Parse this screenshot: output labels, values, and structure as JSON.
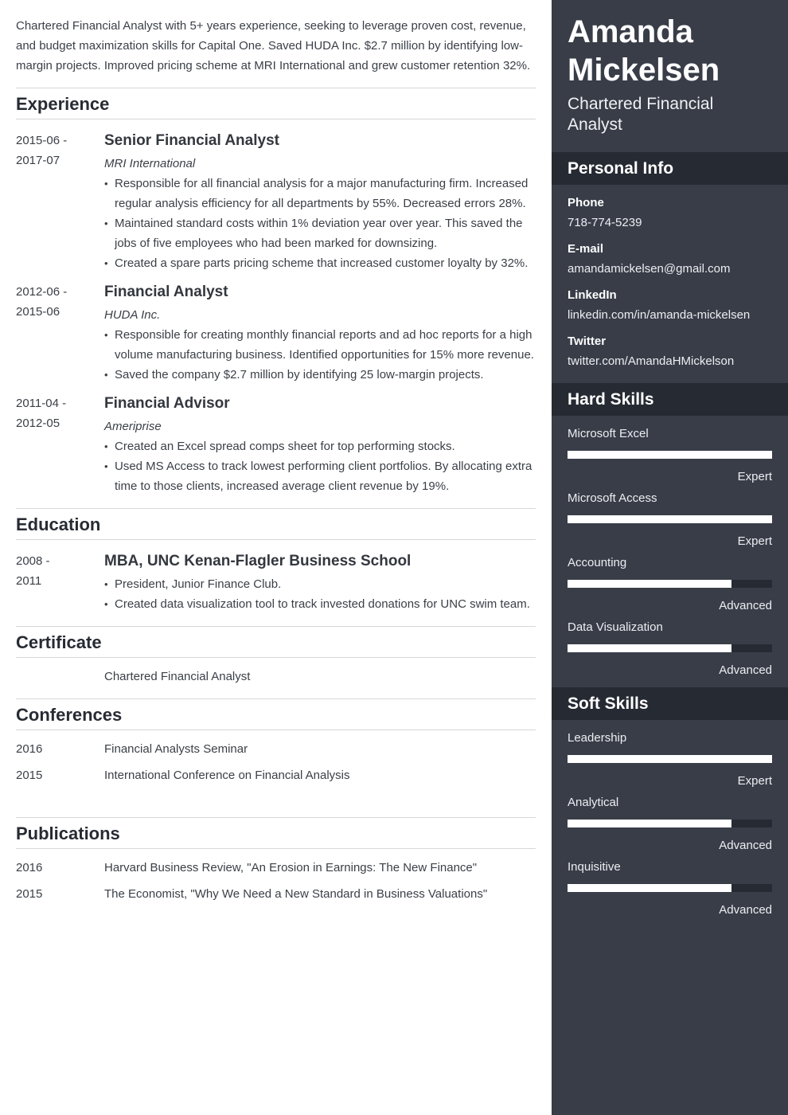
{
  "summary": "Chartered Financial Analyst with 5+ years experience, seeking to leverage proven cost, revenue, and budget maximization skills for Capital One. Saved HUDA Inc. $2.7 million by identifying low-margin projects. Improved pricing scheme at MRI International and grew customer retention 32%.",
  "sections": {
    "experience": "Experience",
    "education": "Education",
    "certificate": "Certificate",
    "conferences": "Conferences",
    "publications": "Publications"
  },
  "experience": [
    {
      "dates": [
        "2015-06 -",
        "2017-07"
      ],
      "role": "Senior Financial Analyst",
      "company": "MRI International",
      "bullets": [
        "Responsible for all financial analysis for a major manufacturing firm. Increased regular analysis efficiency for all departments by 55%. Decreased errors 28%.",
        "Maintained standard costs within 1% deviation year over year. This saved the jobs of five employees who had been marked for downsizing.",
        "Created a spare parts pricing scheme that increased customer loyalty by 32%."
      ]
    },
    {
      "dates": [
        "2012-06 -",
        "2015-06"
      ],
      "role": "Financial Analyst",
      "company": "HUDA Inc.",
      "bullets": [
        "Responsible for creating monthly financial reports and ad hoc reports for a high volume manufacturing business. Identified opportunities for 15% more revenue.",
        "Saved the company $2.7 million by identifying 25 low-margin projects."
      ]
    },
    {
      "dates": [
        "2011-04 -",
        "2012-05"
      ],
      "role": "Financial Advisor",
      "company": "Ameriprise",
      "bullets": [
        "Created an Excel spread comps sheet for top performing stocks.",
        "Used MS Access to track lowest performing client portfolios. By allocating extra time to those clients, increased average client revenue by 19%."
      ]
    }
  ],
  "education": [
    {
      "dates": [
        "2008 -",
        "2011"
      ],
      "degree": "MBA, UNC Kenan-Flagler Business School",
      "bullets": [
        "President, Junior Finance Club.",
        "Created data visualization tool to track invested donations for UNC swim team."
      ]
    }
  ],
  "certificates": [
    "Chartered Financial Analyst"
  ],
  "conferences": [
    {
      "year": "2016",
      "title": "Financial Analysts Seminar"
    },
    {
      "year": "2015",
      "title": "International Conference on Financial Analysis"
    }
  ],
  "publications": [
    {
      "year": "2016",
      "title": "Harvard Business Review, \"An Erosion in Earnings: The New Finance\""
    },
    {
      "year": "2015",
      "title": "The Economist, \"Why We Need a New Standard in Business Valuations\""
    }
  ],
  "sidebar": {
    "name_first": "Amanda",
    "name_last": "Mickelsen",
    "title": "Chartered Financial Analyst",
    "personal_info_heading": "Personal Info",
    "personal_info": [
      {
        "label": "Phone",
        "value": "718-774-5239"
      },
      {
        "label": "E-mail",
        "value": "amandamickelsen@gmail.com"
      },
      {
        "label": "LinkedIn",
        "value": "linkedin.com/in/amanda-mickelsen"
      },
      {
        "label": "Twitter",
        "value": "twitter.com/AmandaHMickelson"
      }
    ],
    "hard_skills_heading": "Hard Skills",
    "hard_skills": [
      {
        "name": "Microsoft Excel",
        "level": "Expert",
        "fill_percent": 100
      },
      {
        "name": "Microsoft Access",
        "level": "Expert",
        "fill_percent": 100
      },
      {
        "name": "Accounting",
        "level": "Advanced",
        "fill_percent": 80
      },
      {
        "name": "Data Visualization",
        "level": "Advanced",
        "fill_percent": 80
      }
    ],
    "soft_skills_heading": "Soft Skills",
    "soft_skills": [
      {
        "name": "Leadership",
        "level": "Expert",
        "fill_percent": 100
      },
      {
        "name": "Analytical",
        "level": "Advanced",
        "fill_percent": 80
      },
      {
        "name": "Inquisitive",
        "level": "Advanced",
        "fill_percent": 80
      }
    ]
  },
  "colors": {
    "sidebar_bg": "#383d48",
    "sidebar_band": "#262a33",
    "heading_text": "#272b33",
    "body_text": "#3a3f47"
  }
}
